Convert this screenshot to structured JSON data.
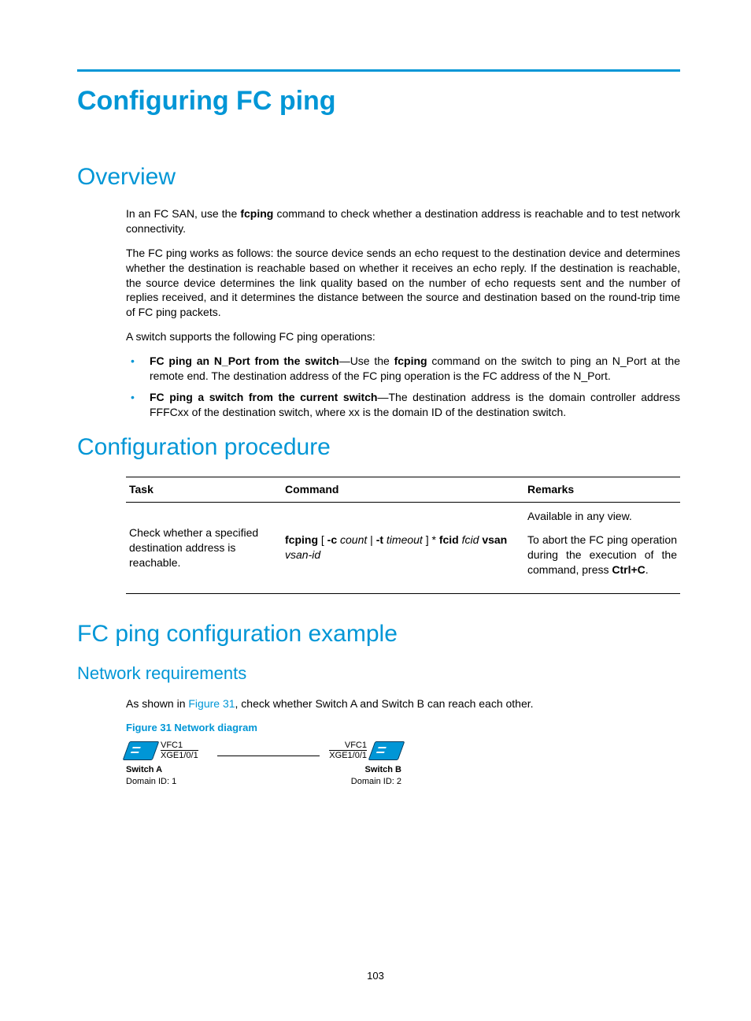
{
  "title": "Configuring FC ping",
  "overview": {
    "heading": "Overview",
    "p1_a": "In an FC SAN, use the ",
    "p1_cmd": "fcping",
    "p1_b": " command to check whether a destination address is reachable and to test network connectivity.",
    "p2": "The FC ping works as follows: the source device sends an echo request to the destination device and determines whether the destination is reachable based on whether it receives an echo reply. If the destination is reachable, the source device determines the link quality based on the number of echo requests sent and the number of replies received, and it determines the distance between the source and destination based on the round-trip time of FC ping packets.",
    "p3": "A switch supports the following FC ping operations:",
    "b1_strong": "FC ping an N_Port from the switch",
    "b1_a": "—Use the ",
    "b1_cmd": "fcping",
    "b1_b": " command on the switch to ping an N_Port at the remote end. The destination address of the FC ping operation is the FC address of the N_Port.",
    "b2_strong": "FC ping a switch from the current switch",
    "b2_a": "—The destination address is the domain controller address FFFCxx of the destination switch, where xx is the domain ID of the destination switch."
  },
  "config": {
    "heading": "Configuration procedure",
    "th_task": "Task",
    "th_cmd": "Command",
    "th_rem": "Remarks",
    "task": "Check whether a specified destination address is reachable.",
    "cmd_parts": {
      "p1": "fcping",
      "p2": " [ ",
      "p3": "-c",
      "p4": " count",
      "p5": " | ",
      "p6": "-t",
      "p7": " timeout",
      "p8": " ] * ",
      "p9": "fcid",
      "p10": " fcid ",
      "p11": "vsan",
      "p12": " vsan-id"
    },
    "rem1": "Available in any view.",
    "rem2_a": "To abort the FC ping operation during the execution of the command, press ",
    "rem2_b": "Ctrl+C",
    "rem2_c": "."
  },
  "example": {
    "heading": "FC ping configuration example",
    "sub": "Network requirements",
    "p_a": "As shown in ",
    "p_link": "Figure 31",
    "p_b": ", check whether Switch A and Switch B can reach each other.",
    "fig_caption": "Figure 31 Network diagram",
    "nodeA": {
      "vfc": "VFC1",
      "xge": "XGE1/0/1",
      "name": "Switch A",
      "domain": "Domain ID: 1"
    },
    "nodeB": {
      "vfc": "VFC1",
      "xge": "XGE1/0/1",
      "name": "Switch B",
      "domain": "Domain ID: 2"
    }
  },
  "page_number": "103"
}
